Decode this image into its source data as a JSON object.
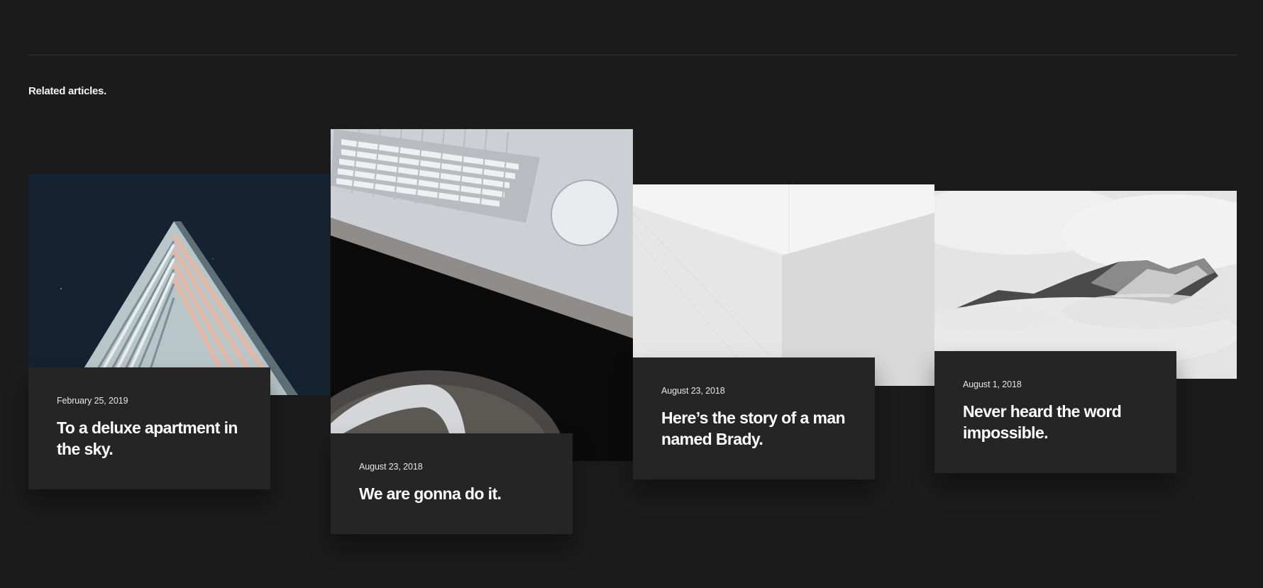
{
  "section": {
    "heading": "Related articles."
  },
  "articles": [
    {
      "date": "February 25, 2019",
      "title": "To a deluxe apartment in the sky.",
      "image": "building-triangle-photo"
    },
    {
      "date": "August 23, 2018",
      "title": "We are gonna do it.",
      "image": "desk-keyboard-mouse-photo"
    },
    {
      "date": "August 23, 2018",
      "title": "Here’s the story of a man named Brady.",
      "image": "white-wall-photo"
    },
    {
      "date": "August 1, 2018",
      "title": "Never heard the word impossible.",
      "image": "misty-mountain-photo"
    }
  ],
  "colors": {
    "background": "#1b1b1b",
    "card": "#252525",
    "text": "#ffffff"
  }
}
